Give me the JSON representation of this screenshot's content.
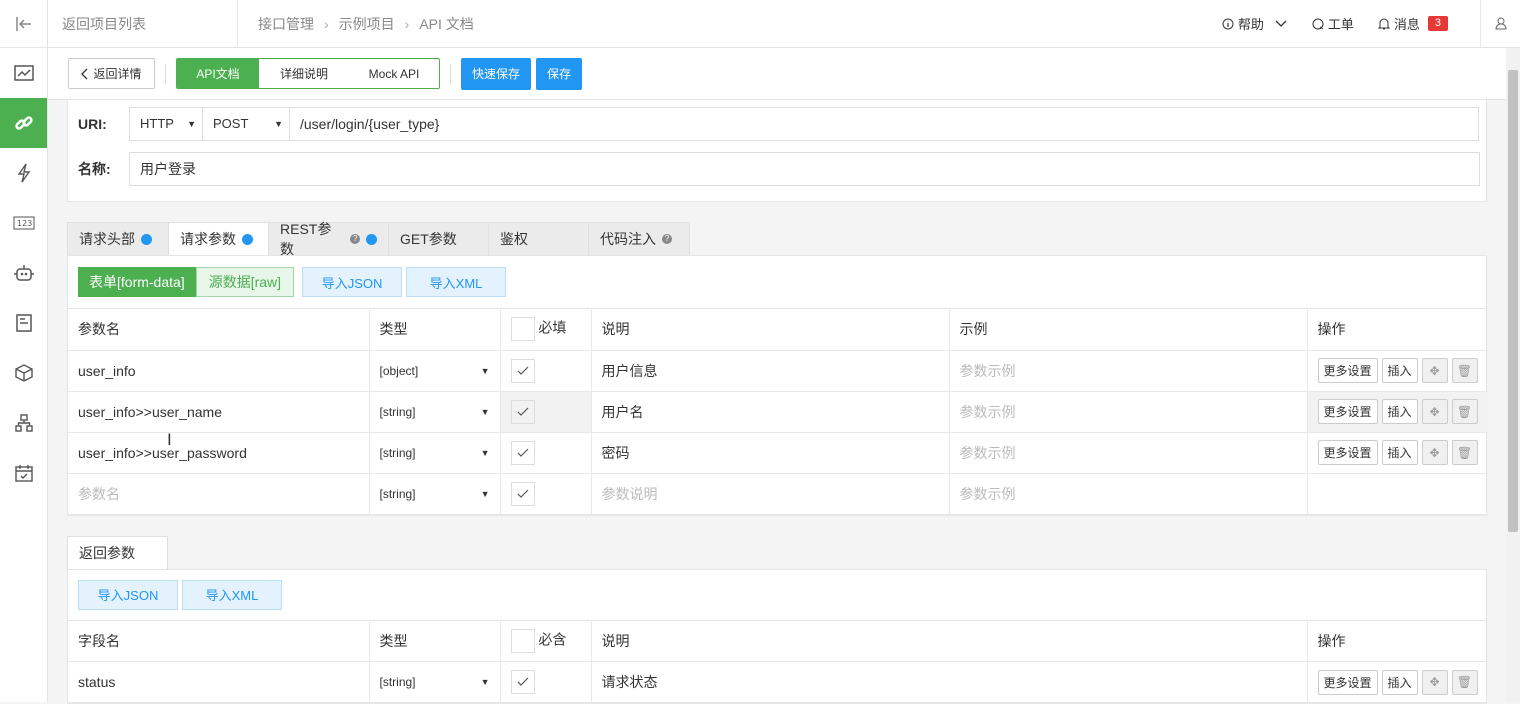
{
  "topbar": {
    "back_to_list": "返回项目列表",
    "breadcrumb": [
      "接口管理",
      "示例项目",
      "API 文档"
    ],
    "help": "帮助",
    "ticket": "工单",
    "messages": "消息",
    "message_count": "3"
  },
  "toolbar": {
    "back_details": "返回详情",
    "tabs": [
      "API文档",
      "详细说明",
      "Mock API"
    ],
    "quick_save": "快速保存",
    "save": "保存"
  },
  "form": {
    "uri_label": "URI:",
    "protocol": "HTTP",
    "method": "POST",
    "uri": "/user/login/{user_type}",
    "name_label": "名称:",
    "name": "用户登录"
  },
  "request_tabs": [
    "请求头部",
    "请求参数",
    "REST参数",
    "GET参数",
    "鉴权",
    "代码注入"
  ],
  "request_panel": {
    "form_data": "表单[form-data]",
    "raw": "源数据[raw]",
    "import_json": "导入JSON",
    "import_xml": "导入XML",
    "headers": {
      "name": "参数名",
      "type": "类型",
      "required": "必填",
      "desc": "说明",
      "example": "示例",
      "ops": "操作"
    },
    "rows": [
      {
        "name": "user_info",
        "type": "[object]",
        "desc": "用户信息",
        "example": "参数示例"
      },
      {
        "name": "user_info>>user_name",
        "type": "[string]",
        "desc": "用户名",
        "example": "参数示例"
      },
      {
        "name": "user_info>>user_password",
        "type": "[string]",
        "desc": "密码",
        "example": "参数示例"
      },
      {
        "name": "参数名",
        "type": "[string]",
        "desc": "参数说明",
        "example": "参数示例"
      }
    ],
    "more_settings": "更多设置",
    "insert": "插入"
  },
  "response": {
    "tab": "返回参数",
    "import_json": "导入JSON",
    "import_xml": "导入XML",
    "headers": {
      "name": "字段名",
      "type": "类型",
      "required": "必含",
      "desc": "说明",
      "ops": "操作"
    },
    "rows": [
      {
        "name": "status",
        "type": "[string]",
        "desc": "请求状态"
      }
    ]
  },
  "colors": {
    "green": "#4caf50",
    "blue": "#2196f3",
    "badge": "#e53935"
  }
}
